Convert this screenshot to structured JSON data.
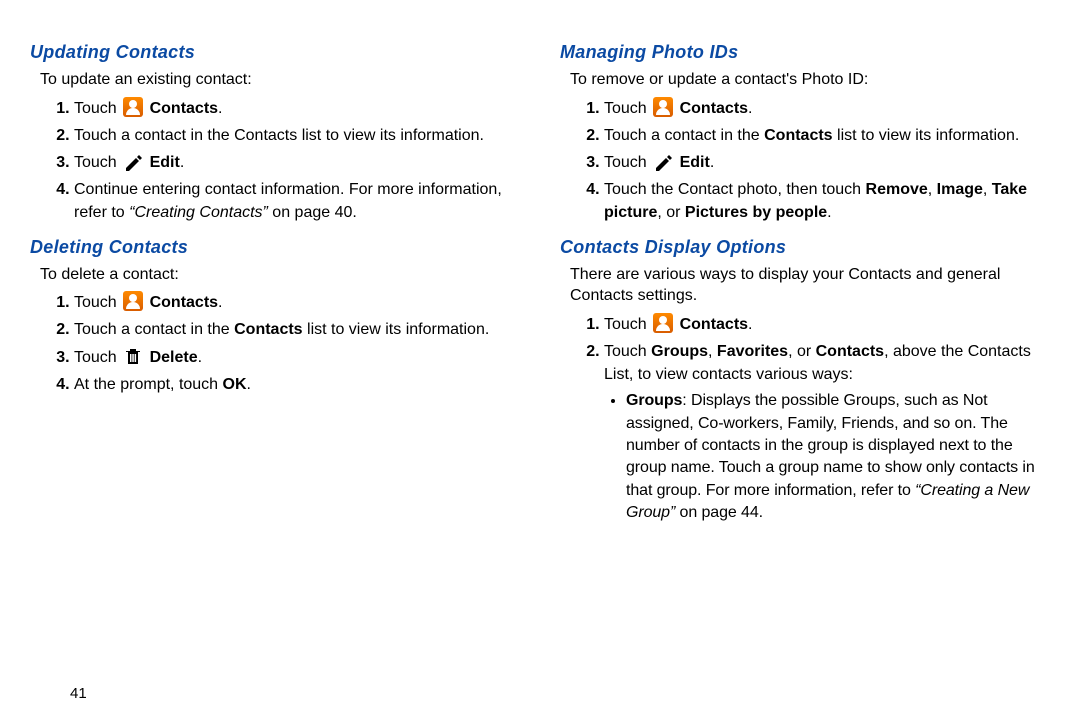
{
  "page_number": "41",
  "left": {
    "s1": {
      "title": "Updating Contacts",
      "intro": "To update an existing contact:",
      "st1a": "Touch ",
      "st1b": "Contacts",
      "st1c": ".",
      "st2": "Touch a contact in the Contacts list to view its information.",
      "st3a": "Touch ",
      "st3b": "Edit",
      "st3c": ".",
      "st4a": "Continue entering contact information. For more information, refer to ",
      "st4b": "“Creating Contacts”",
      "st4c": " on page 40."
    },
    "s2": {
      "title": "Deleting Contacts",
      "intro": "To delete a contact:",
      "st1a": "Touch ",
      "st1b": "Contacts",
      "st1c": ".",
      "st2a": "Touch a contact in the ",
      "st2b": "Contacts",
      "st2c": " list to view its information.",
      "st3a": "Touch ",
      "st3b": "Delete",
      "st3c": ".",
      "st4a": "At the prompt, touch ",
      "st4b": "OK",
      "st4c": "."
    }
  },
  "right": {
    "s3": {
      "title": "Managing Photo IDs",
      "intro": "To remove or update a contact's Photo ID:",
      "st1a": "Touch ",
      "st1b": "Contacts",
      "st1c": ".",
      "st2a": "Touch a contact in the ",
      "st2b": "Contacts",
      "st2c": " list to view its information.",
      "st3a": "Touch ",
      "st3b": "Edit",
      "st3c": ".",
      "st4a": "Touch the Contact photo, then touch ",
      "st4b": "Remove",
      "st4c": ", ",
      "st4d": "Image",
      "st4e": ", ",
      "st4f": "Take picture",
      "st4g": ", or ",
      "st4h": "Pictures by people",
      "st4i": "."
    },
    "s4": {
      "title": "Contacts Display Options",
      "intro": "There are various ways to display your Contacts and general Contacts settings.",
      "st1a": "Touch ",
      "st1b": "Contacts",
      "st1c": ".",
      "st2a": "Touch ",
      "st2b": "Groups",
      "st2c": ", ",
      "st2d": "Favorites",
      "st2e": ", or ",
      "st2f": "Contacts",
      "st2g": ", above the Contacts List, to view contacts various ways:",
      "b1a": "Groups",
      "b1b": ": Displays the possible Groups, such as Not assigned, Co-workers, Family, Friends, and so on. The number of contacts in the group is displayed next to the group name. Touch a group name to show only contacts in that group. For more information, refer to ",
      "b1c": "“Creating a New Group”",
      "b1d": " on page 44."
    }
  },
  "chart_data": null
}
